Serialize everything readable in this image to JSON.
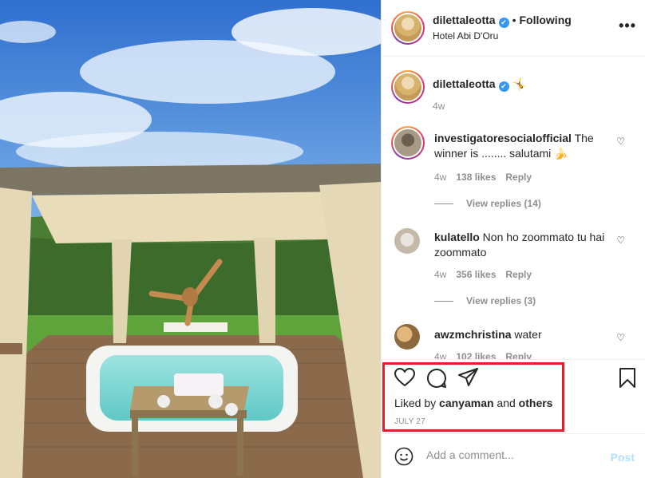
{
  "post": {
    "image_alt": "Woman doing yoga under gazebo next to hot tub"
  },
  "header": {
    "username": "dilettaleotta",
    "verified_symbol": "✔",
    "dot": "•",
    "following": "Following",
    "location": "Hotel Abi D'Oru",
    "more": "•••"
  },
  "caption": {
    "username": "dilettaleotta",
    "emoji": "🤸",
    "time": "4w"
  },
  "comments": [
    {
      "username": "investigatoresocialofficial",
      "text": " The winner is ........ salutami 🍌",
      "time": "4w",
      "likes": "138 likes",
      "reply": "Reply",
      "view_replies": "View replies (14)"
    },
    {
      "username": "kulatello",
      "text": " Non ho zoommato tu hai zoommato",
      "time": "4w",
      "likes": "356 likes",
      "reply": "Reply",
      "view_replies": "View replies (3)"
    },
    {
      "username": "awzmchristina",
      "text": " water",
      "time": "4w",
      "likes": "102 likes",
      "reply": "Reply"
    }
  ],
  "actions": {
    "liked_prefix": "Liked by ",
    "liked_user": "canyaman",
    "liked_and": " and ",
    "liked_others": "others",
    "date": "JULY 27"
  },
  "add_comment": {
    "placeholder": "Add a comment...",
    "post": "Post"
  },
  "colors": {
    "accent_blue": "#3897f0",
    "post_disabled": "#b2dffc",
    "highlight_red": "#e0202a",
    "muted": "#8e8e8e"
  }
}
